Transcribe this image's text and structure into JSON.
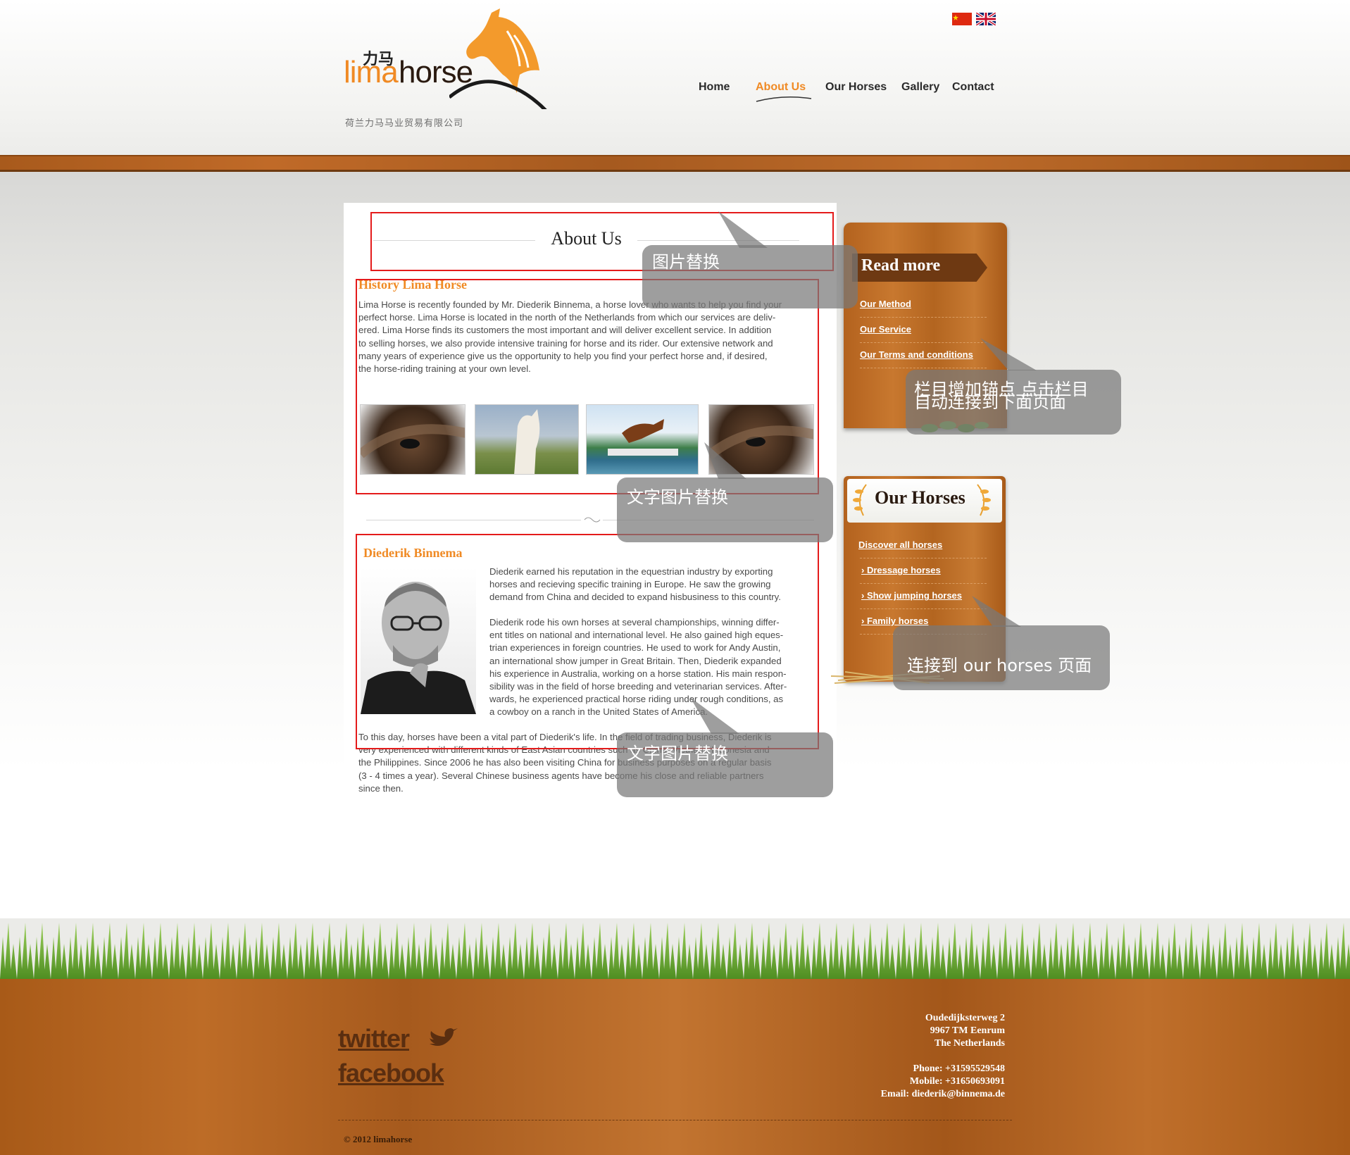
{
  "flags": [
    "china-flag-icon",
    "uk-flag-icon"
  ],
  "logo": {
    "cn": "力马",
    "lima": "lima",
    "horse": "horse",
    "tagline": "荷兰力马马业贸易有限公司"
  },
  "nav": {
    "home": "Home",
    "about": "About Us",
    "horses": "Our Horses",
    "gallery": "Gallery",
    "contact": "Contact"
  },
  "main": {
    "heading": "About Us",
    "history": {
      "title": "History Lima Horse",
      "lines": [
        "Lima Horse is recently founded by Mr. Diederik Binnema, a horse lover who wants to help you find your",
        "perfect horse. Lima Horse is located in the north of the Netherlands from which our services are deliv-",
        "ered. Lima Horse finds its customers the most important and will deliver excellent service. In addition",
        " to selling horses, we also provide intensive training for horse and its rider. Our extensive network and",
        "many years of experience give us the opportunity to help you find your perfect horse and, if desired,",
        "the horse-riding training at your own level."
      ]
    },
    "person": {
      "title": "Diederik Binnema",
      "para1": [
        "Diederik earned his reputation in the equestrian industry by exporting",
        "horses and recieving specific  training in Europe. He saw the growing",
        "demand from China and decided to expand hisbusiness to this country."
      ],
      "para2": [
        "Diederik rode his own horses at several championships, winning differ-",
        "ent titles on national and international level. He also gained high eques-",
        "trian experiences in foreign countries. He used to work for Andy Austin,",
        "an international show jumper in Great Britain. Then, Diederik expanded",
        "his experience in Australia, working on a horse station. His main respon-",
        "sibility was in the field of horse breeding and veterinarian services. After-",
        "wards, he experienced practical horse riding under rough conditions, as",
        "a cowboy on a ranch in the United States of America."
      ],
      "para3": [
        "To this day, horses have been a vital part of Diederik's life. In the field of trading business, Diederik is",
        "very experienced with different kinds of East Asian countries such as China, Vietnam, Indonesia and",
        "the Philippines. Since 2006 he has also been visiting China for business purposes on a regular basis",
        "(3 - 4 times a year). Several Chinese business agents have become his close and reliable partners",
        "since then."
      ]
    }
  },
  "sidebar": {
    "read_more": {
      "title": "Read more",
      "links": [
        "Our Method",
        "Our Service",
        "Our Terms and conditions"
      ]
    },
    "our_horses": {
      "title": "Our Horses",
      "links": [
        "Discover all horses",
        "› Dressage horses",
        "› Show jumping horses",
        "› Family horses"
      ]
    }
  },
  "callouts": {
    "c1": "图片替换",
    "c2_line1": "栏目增加锚点 点击栏目",
    "c2_line2": "自动连接到下面页面",
    "c3": "文字图片替换",
    "c4": "连接到 our horses 页面",
    "c5": "文字图片替换"
  },
  "footer": {
    "twitter": "twitter",
    "facebook": "facebook",
    "address": [
      "Oudedijksterweg 2",
      "9967 TM Eenrum",
      "The Netherlands"
    ],
    "phone": "Phone: +31595529548",
    "mobile": "Mobile: +31650693091",
    "email": "Email: diederik@binnema.de",
    "copyright": "© 2012 limahorse"
  },
  "colors": {
    "accent": "#f08a24",
    "wood": "#b3621e",
    "annotation_red": "#e41b1b",
    "callout_gray": "#787878"
  }
}
